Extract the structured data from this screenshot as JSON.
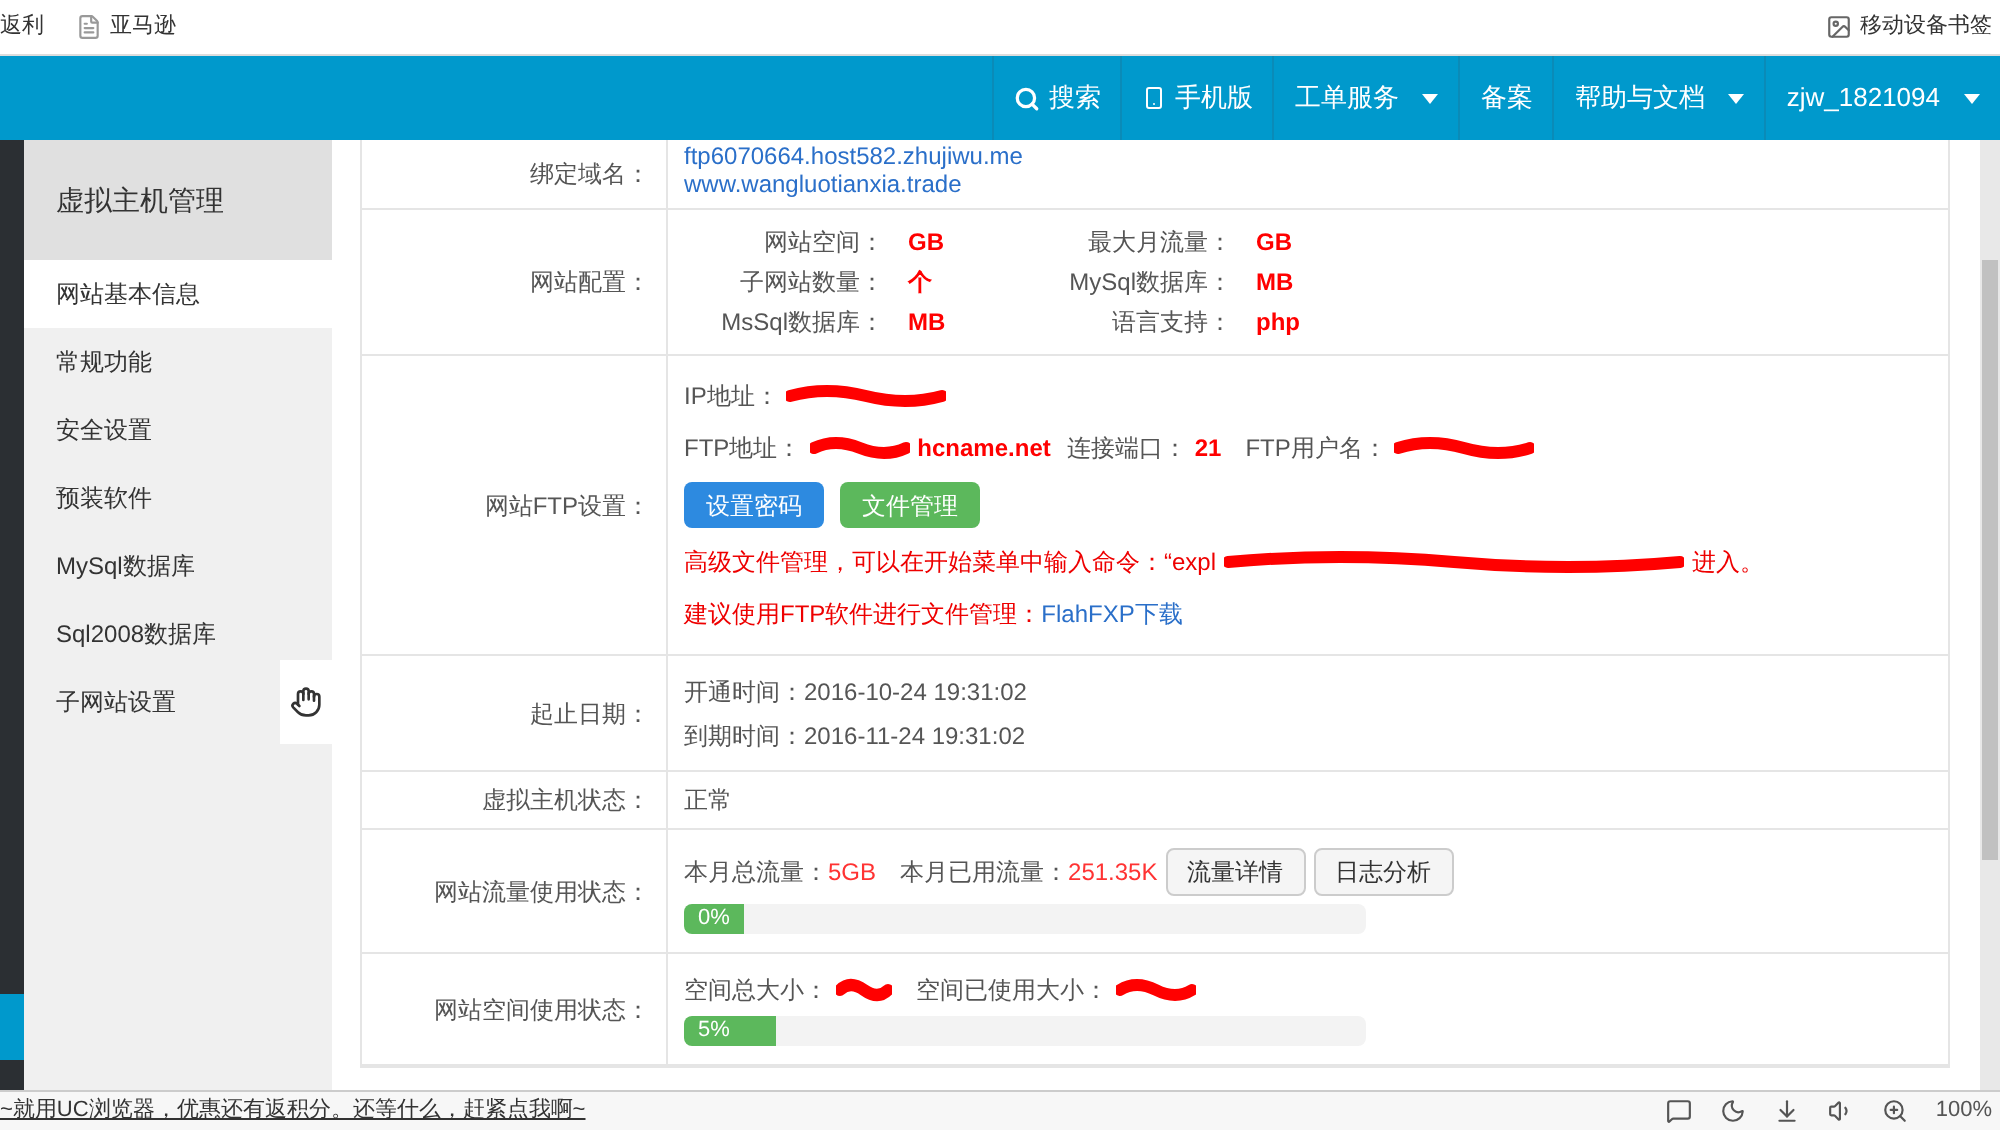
{
  "bookmarks": [
    {
      "label": "返利",
      "icon": false
    },
    {
      "label": "亚马逊",
      "icon": true
    }
  ],
  "mobile_bookmarks": "移动设备书签",
  "nav": [
    {
      "label": "搜索",
      "dropdown": false
    },
    {
      "label": "手机版",
      "dropdown": false
    },
    {
      "label": "工单服务",
      "dropdown": true
    },
    {
      "label": "备案",
      "dropdown": false
    },
    {
      "label": "帮助与文档",
      "dropdown": true
    },
    {
      "label": "zjw_1821094",
      "dropdown": true
    }
  ],
  "sidebar": {
    "title": "虚拟主机管理",
    "items": [
      {
        "label": "网站基本信息",
        "selected": true
      },
      {
        "label": "常规功能",
        "selected": false
      },
      {
        "label": "安全设置",
        "selected": false
      },
      {
        "label": "预装软件",
        "selected": false
      },
      {
        "label": "MySql数据库",
        "selected": false
      },
      {
        "label": "Sql2008数据库",
        "selected": false
      },
      {
        "label": "子网站设置",
        "selected": false
      }
    ]
  },
  "domains": {
    "label": "绑定域名：",
    "values": [
      "ftp6070664.host582.zhujiwu.me",
      "www.wangluotianxia.trade"
    ]
  },
  "config": {
    "label": "网站配置：",
    "items": [
      {
        "name": "网站空间：",
        "value": "GB"
      },
      {
        "name": "最大月流量：",
        "value": "GB"
      },
      {
        "name": "子网站数量：",
        "value": "个"
      },
      {
        "name": "MySql数据库：",
        "value": "MB"
      },
      {
        "name": "MsSql数据库：",
        "value": "MB"
      },
      {
        "name": "语言支持：",
        "value": "php"
      }
    ]
  },
  "ftp": {
    "label": "网站FTP设置：",
    "ip_label": "IP地址：",
    "addr_label": "FTP地址：",
    "addr_value": "hcname.net",
    "port_label": "连接端口：",
    "port": "21",
    "user_label": "FTP用户名：",
    "buttons": [
      {
        "label": "设置密码",
        "kind": "primary"
      },
      {
        "label": "文件管理",
        "kind": "success"
      }
    ],
    "note1_a": "高级文件管理，可以在开始菜单中输入命令：“expl",
    "note1_b": "进入。",
    "note2": "建议使用FTP软件进行文件管理：",
    "note2_link": "FlahFXP下载"
  },
  "dates": {
    "label": "起止日期：",
    "lines": [
      "开通时间：2016-10-24 19:31:02",
      "到期时间：2016-11-24 19:31:02"
    ]
  },
  "status": {
    "label": "虚拟主机状态：",
    "value": "正常"
  },
  "traffic": {
    "label": "网站流量使用状态：",
    "total_label": "本月总流量：",
    "total": "5GB",
    "used_label": "本月已用流量：",
    "used": "251.35K",
    "buttons": [
      "流量详情",
      "日志分析"
    ],
    "reading": "0%"
  },
  "space": {
    "label": "网站空间使用状态：",
    "total_label": "空间总大小：",
    "used_label": "空间已使用大小：",
    "level": 0.05,
    "reading": "5%"
  },
  "status_bar": {
    "ad": "~就用UC浏览器，优惠还有返积分。还等什么，赶紧点我啊~",
    "zoom": "100%"
  }
}
